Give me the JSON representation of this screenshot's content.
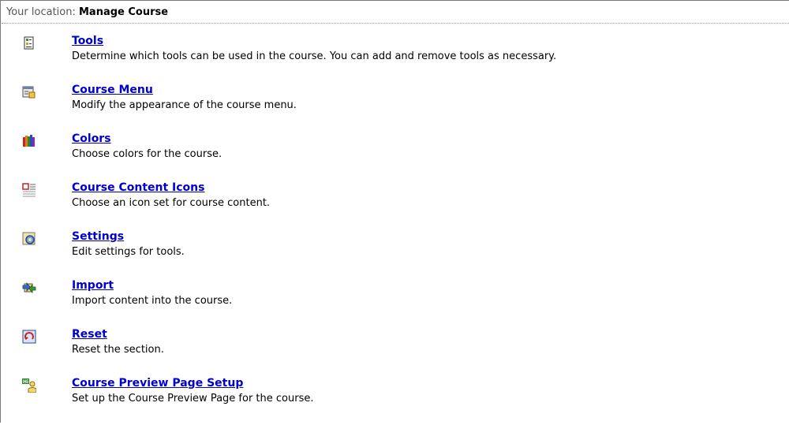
{
  "location": {
    "prefix": "Your location:",
    "current": "Manage Course"
  },
  "items": [
    {
      "icon": "tools-icon",
      "title": "Tools",
      "description": "Determine which tools can be used in the course. You can add and remove tools as necessary."
    },
    {
      "icon": "course-menu-icon",
      "title": "Course Menu",
      "description": "Modify the appearance of the course menu."
    },
    {
      "icon": "colors-icon",
      "title": "Colors",
      "description": "Choose colors for the course."
    },
    {
      "icon": "content-icons-icon",
      "title": "Course Content Icons",
      "description": "Choose an icon set for course content."
    },
    {
      "icon": "settings-icon",
      "title": "Settings",
      "description": "Edit settings for tools."
    },
    {
      "icon": "import-icon",
      "title": "Import",
      "description": "Import content into the course."
    },
    {
      "icon": "reset-icon",
      "title": "Reset",
      "description": "Reset the section."
    },
    {
      "icon": "preview-setup-icon",
      "title": "Course Preview Page Setup",
      "description": "Set up the Course Preview Page for the course."
    }
  ]
}
